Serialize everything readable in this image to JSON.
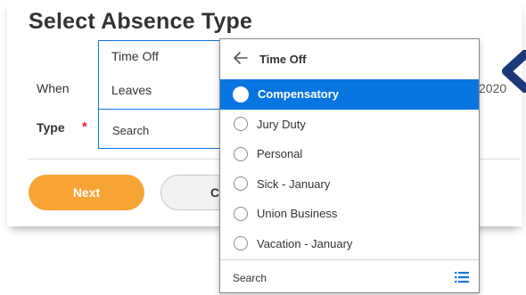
{
  "page": {
    "title": "Select Absence Type"
  },
  "form": {
    "when_label": "When",
    "type_label": "Type",
    "required_mark": "*",
    "when_value_fragment": "2020"
  },
  "category_menu": {
    "items": [
      {
        "label": "Time Off"
      },
      {
        "label": "Leaves"
      }
    ],
    "search_placeholder": "Search"
  },
  "options_menu": {
    "header": "Time Off",
    "items": [
      {
        "label": "Compensatory",
        "selected": true
      },
      {
        "label": "Jury Duty"
      },
      {
        "label": "Personal"
      },
      {
        "label": "Sick - January"
      },
      {
        "label": "Union Business"
      },
      {
        "label": "Vacation - January"
      }
    ],
    "search_label": "Search",
    "list_icon": "list-icon"
  },
  "buttons": {
    "next": "Next",
    "cancel": "Ca"
  },
  "colors": {
    "accent_blue": "#0875e1",
    "next_orange": "#f7a434",
    "required_red": "#de2a2a",
    "arrow_navy": "#1c3a7a"
  }
}
